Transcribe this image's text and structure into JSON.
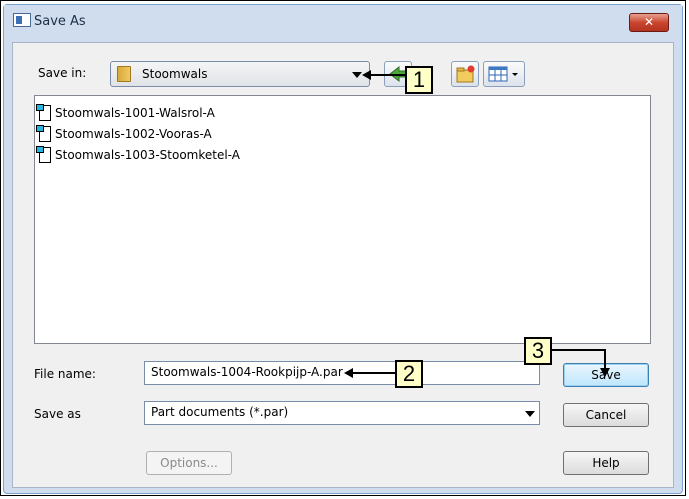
{
  "window": {
    "title": "Save As",
    "close_glyph": "✕"
  },
  "save_in": {
    "label": "Save in:",
    "value": "Stoomwals"
  },
  "files": [
    {
      "name": "Stoomwals-1001-Walsrol-A"
    },
    {
      "name": "Stoomwals-1002-Vooras-A"
    },
    {
      "name": "Stoomwals-1003-Stoomketel-A"
    }
  ],
  "file_name": {
    "label": "File name:",
    "value": "Stoomwals-1004-Rookpijp-A.par"
  },
  "save_as": {
    "label": "Save as",
    "value": "Part documents (*.par)"
  },
  "buttons": {
    "options": "Options...",
    "save": "Save",
    "cancel": "Cancel",
    "help": "Help"
  },
  "callouts": [
    "1",
    "2",
    "3"
  ],
  "colors": {
    "callout_fill": "#ffffc8",
    "close_red": "#c9462f",
    "frame": "#cfddee"
  }
}
